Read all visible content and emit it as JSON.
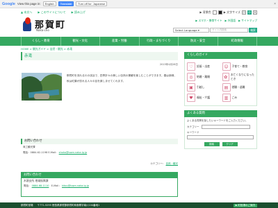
{
  "google_bar": {
    "logo": "Google",
    "prompt": "View this page in:",
    "language": "English",
    "translate_label": "Translate",
    "turn_off_label": "Turn off for: Japanese",
    "close": "×"
  },
  "topnav": {
    "items": [
      "▲ 本文へ",
      "▶ このサイトについて",
      "▶ 読み上げ",
      "▶ 背景色",
      "▶ 文字サイズ"
    ],
    "sizes": [
      "小",
      "中",
      "大"
    ]
  },
  "header": {
    "title": "那賀町",
    "subtitle": "Naka-cho",
    "links": [
      "▶ スマホ・携帯サイト",
      "▶ 外国語",
      "▶ サイトマップ"
    ],
    "search_language": "Select Language ▾",
    "search_placeholder": "サイト内検索",
    "search_button": "検索"
  },
  "global_nav": [
    "くらし・教育",
    "観光・文化",
    "産業・労働",
    "行政・まちづくり",
    "防災・安全",
    "町政情報"
  ],
  "breadcrumb": "HOME > 観光ガイド > 自然・観光 > 赤滝",
  "page": {
    "title": "赤滝",
    "date": "2015年4月28日",
    "body": "那賀町を流れる川の渓谷で、四季折々の美しい自然の景観を楽しむことができます。春は新緑、秋は紅葉が訪れる人々の目を楽しませてくれます。"
  },
  "inquiry1": {
    "title": "お問い合わせ",
    "dept": "商工観光課",
    "tel": "電話：0884-62-1198",
    "email_label": "E-Mail：",
    "email": "shoko@town.naka.lg.jp"
  },
  "category": {
    "label": "カテゴリー：",
    "link": "自然・観光"
  },
  "inquiry2": {
    "title": "お問い合わせ",
    "dept": "木頭支所 地域振興課",
    "tel_label": "電話：",
    "tel": "0884-68-1110",
    "email_label": "E-Mail：",
    "email": "kitou@town.naka.lg.jp"
  },
  "side": {
    "guide_title": "くらしのガイド",
    "guide_items": [
      {
        "label": "妊娠・出産",
        "icon": "baby-icon",
        "glyph": "♡"
      },
      {
        "label": "子育て・教育",
        "icon": "child-icon",
        "glyph": "☺"
      },
      {
        "label": "結婚・離婚",
        "icon": "rings-icon",
        "glyph": "◎"
      },
      {
        "label": "お亡くなりになったとき",
        "icon": "flower-icon",
        "glyph": "✿"
      },
      {
        "label": "引越し",
        "icon": "truck-icon",
        "glyph": "▣"
      },
      {
        "label": "就職・退職",
        "icon": "briefcase-icon",
        "glyph": "▤"
      },
      {
        "label": "福祉・介護",
        "icon": "heart-icon",
        "glyph": "♥"
      },
      {
        "label": "ごみ",
        "icon": "trash-icon",
        "glyph": "▥"
      }
    ],
    "faq_title": "よくある質問",
    "faq_desc": "よくある質問を探したいキーワードをご入力ください。",
    "category_label": "カテゴリー",
    "keyword_label": "キーワード",
    "search_button": "検索",
    "clear_button": "クリア"
  },
  "footer": {
    "name": "那賀町役場",
    "address": "〒771-5295 徳島県那賀郡那賀町和食郷字南川104番地1",
    "badge": "▶ 町役場のご案内"
  }
}
